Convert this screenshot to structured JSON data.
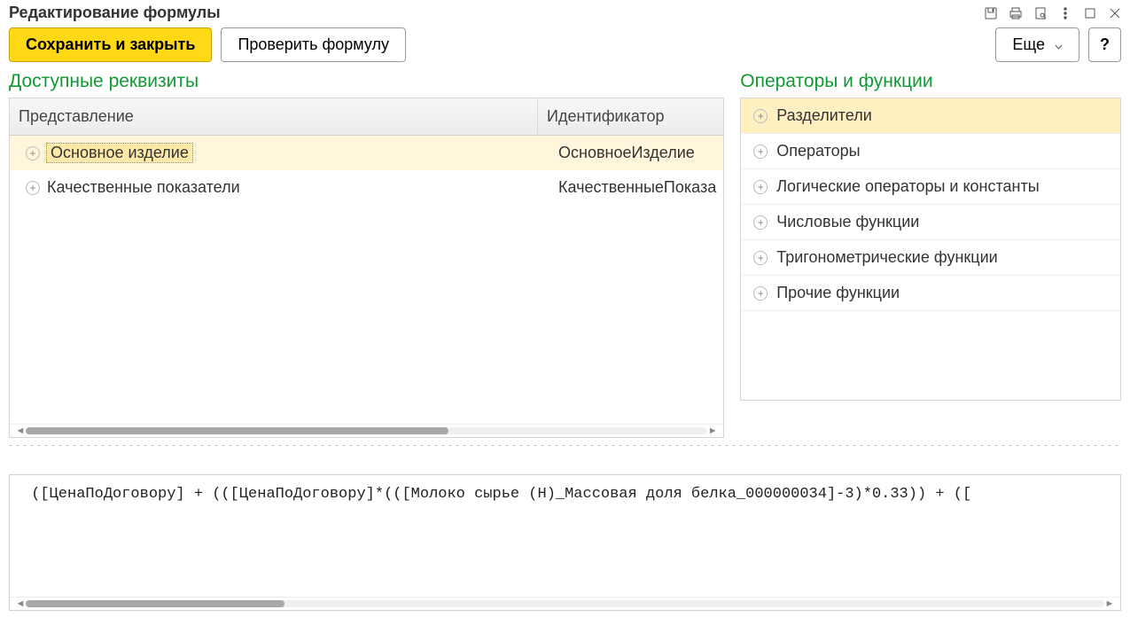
{
  "window": {
    "title": "Редактирование формулы"
  },
  "toolbar": {
    "save_close": "Сохранить и закрыть",
    "check_formula": "Проверить формулу",
    "more": "Еще",
    "help": "?"
  },
  "attributes": {
    "title": "Доступные реквизиты",
    "header_representation": "Представление",
    "header_identifier": "Идентификатор",
    "rows": [
      {
        "representation": "Основное изделие",
        "identifier": "ОсновноеИзделие",
        "selected": true
      },
      {
        "representation": "Качественные показатели",
        "identifier": "КачественныеПоказа",
        "selected": false
      }
    ]
  },
  "operators": {
    "title": "Операторы и функции",
    "groups": [
      {
        "label": "Разделители",
        "selected": true
      },
      {
        "label": "Операторы",
        "selected": false
      },
      {
        "label": "Логические операторы и константы",
        "selected": false
      },
      {
        "label": "Числовые функции",
        "selected": false
      },
      {
        "label": "Тригонометрические функции",
        "selected": false
      },
      {
        "label": "Прочие функции",
        "selected": false
      }
    ]
  },
  "formula": {
    "text": " ([ЦенаПоДоговору] + (([ЦенаПоДоговору]*(([Молоко сырье (Н)_Массовая доля белка_000000034]-3)*0.33)) + ([ "
  }
}
